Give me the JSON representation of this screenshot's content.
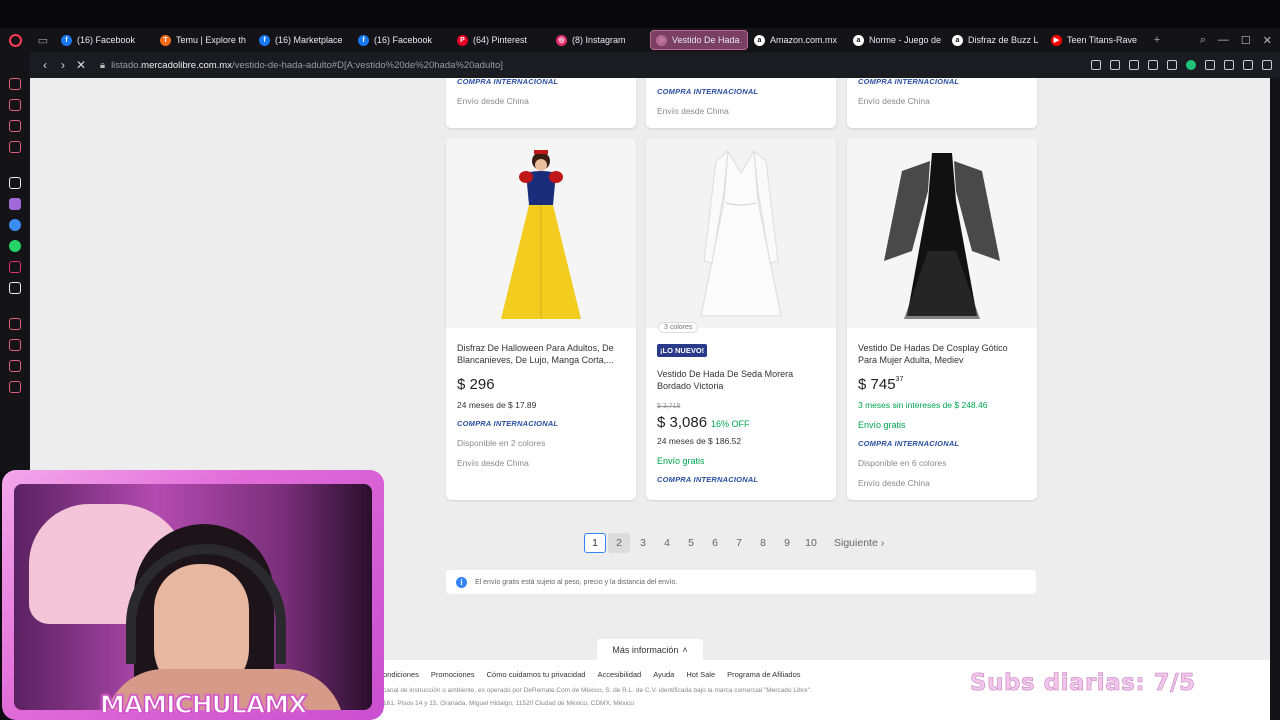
{
  "browser": {
    "tabs": [
      {
        "label": "(16) Facebook",
        "icon": "facebook-icon",
        "color": "#1877f2",
        "glyph": "f"
      },
      {
        "label": "Temu | Explore th",
        "icon": "temu-icon",
        "color": "#f56b16",
        "glyph": "T"
      },
      {
        "label": "(16) Marketplace",
        "icon": "facebook-icon",
        "color": "#1877f2",
        "glyph": "f"
      },
      {
        "label": "(16) Facebook",
        "icon": "facebook-icon",
        "color": "#1877f2",
        "glyph": "f"
      },
      {
        "label": "(64) Pinterest",
        "icon": "pinterest-icon",
        "color": "#e60023",
        "glyph": "P"
      },
      {
        "label": "(8) Instagram",
        "icon": "instagram-icon",
        "color": "#e1306c",
        "glyph": "◎"
      },
      {
        "label": "Vestido De Hada Adulto |",
        "icon": "loading-icon",
        "color": "#b56a92",
        "glyph": "◌",
        "active": true
      },
      {
        "label": "Amazon.com.mx",
        "icon": "amazon-icon",
        "color": "#ffffff",
        "glyph": "a"
      },
      {
        "label": "Norme - Juego de",
        "icon": "amazon-icon",
        "color": "#ffffff",
        "glyph": "a"
      },
      {
        "label": "Disfraz de Buzz L",
        "icon": "amazon-icon",
        "color": "#ffffff",
        "glyph": "a"
      },
      {
        "label": "Teen Titans-Rave",
        "icon": "youtube-icon",
        "color": "#ff0000",
        "glyph": "▶"
      }
    ],
    "url_prefix": "listado.",
    "url_domain": "mercadolibre.com.mx",
    "url_path": "/vestido-de-hada-adulto#D[A:vestido%20de%20hada%20adulto]"
  },
  "top_row": [
    {
      "intl": "COMPRA INTERNACIONAL",
      "ship_from": "Envío desde China"
    },
    {
      "intl": "COMPRA INTERNACIONAL",
      "ship_from": "Envío desde China"
    },
    {
      "intl": "COMPRA INTERNACIONAL",
      "ship_from": "Envío desde China"
    }
  ],
  "products": [
    {
      "title": "Disfraz De Halloween Para Adultos, De Blancanieves, De Lujo, Manga Corta,...",
      "price": "$ 296",
      "installments": "24 meses de $ 17.89",
      "intl": "COMPRA INTERNACIONAL",
      "colors": "Disponible en 2 colores",
      "ship_from": "Envío desde China"
    },
    {
      "colors_pill": "3 colores",
      "badge": "¡LO NUEVO!",
      "title": "Vestido De Hada De Seda Morera Bordado Victoria",
      "old_price": "$ 3,718",
      "price": "$ 3,086",
      "discount": "16% OFF",
      "installments": "24 meses de $ 186.52",
      "shipping": "Envío gratis",
      "intl": "COMPRA INTERNACIONAL"
    },
    {
      "title": "Vestido De Hadas De Cosplay Gótico Para Mujer Adulta, Mediev",
      "price": "$ 745",
      "cents": "37",
      "installments": "3 meses sin intereses de $ 248.46",
      "shipping": "Envío gratis",
      "intl": "COMPRA INTERNACIONAL",
      "colors": "Disponible en 6 colores",
      "ship_from": "Envío desde China"
    }
  ],
  "pagination": {
    "pages": [
      "1",
      "2",
      "3",
      "4",
      "5",
      "6",
      "7",
      "8",
      "9",
      "10"
    ],
    "current": "1",
    "next": "Siguiente"
  },
  "info_note": "El envío gratis está sujeto al peso, precio y la distancia del envío.",
  "more_info": "Más información",
  "footer": {
    "links": [
      "ondiciones",
      "Promociones",
      "Cómo cuidamos tu privacidad",
      "Accesibilidad",
      "Ayuda",
      "Hot Sale",
      "Programa de Afiliados"
    ],
    "line1": "canal de instrucción o ambiente, es operado por DeRemate.Com de México, S. de R.L. de C.V. identificada bajo la marca comercial \"Mercado Libre\".",
    "line2": "161, Pisos 14 y 15, Granada, Miguel Hidalgo, 11520 Ciudad de México, CDMX, México"
  },
  "overlay": {
    "streamer": "MAMICHULAMX",
    "subs": "Subs diarias: 7/5"
  }
}
